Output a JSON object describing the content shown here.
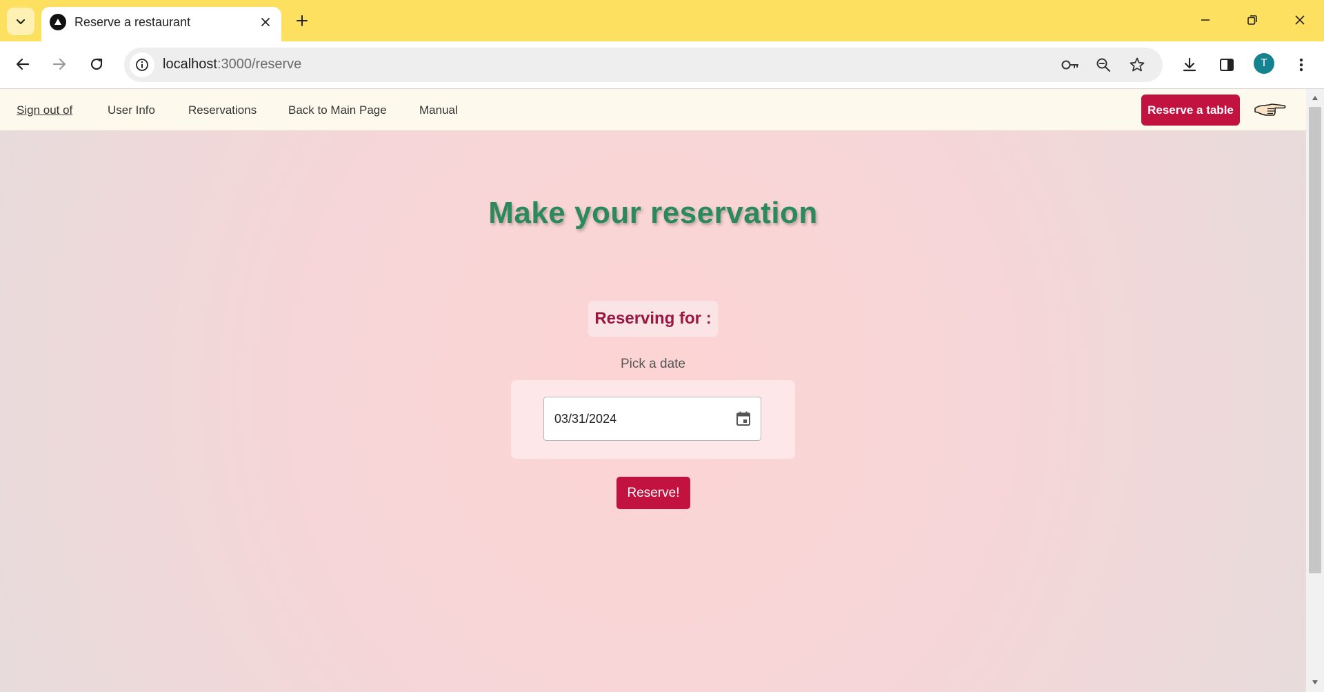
{
  "browser": {
    "tab_title": "Reserve a restaurant",
    "url_host": "localhost",
    "url_path": ":3000/reserve",
    "profile_initial": "T",
    "accent": "#fde05f"
  },
  "nav": {
    "sign_out": "Sign out of",
    "user_info": "User Info",
    "reservations": "Reservations",
    "back_main": "Back to Main Page",
    "manual": "Manual",
    "reserve_table": "Reserve a table"
  },
  "main": {
    "title": "Make your reservation",
    "reserving_for": "Reserving for :",
    "pick_date": "Pick a date",
    "date_value": "03/31/2024",
    "reserve_button": "Reserve!"
  },
  "colors": {
    "brand_red": "#c2123f",
    "title_green": "#2a8a5b",
    "label_maroon": "#9b1640"
  }
}
